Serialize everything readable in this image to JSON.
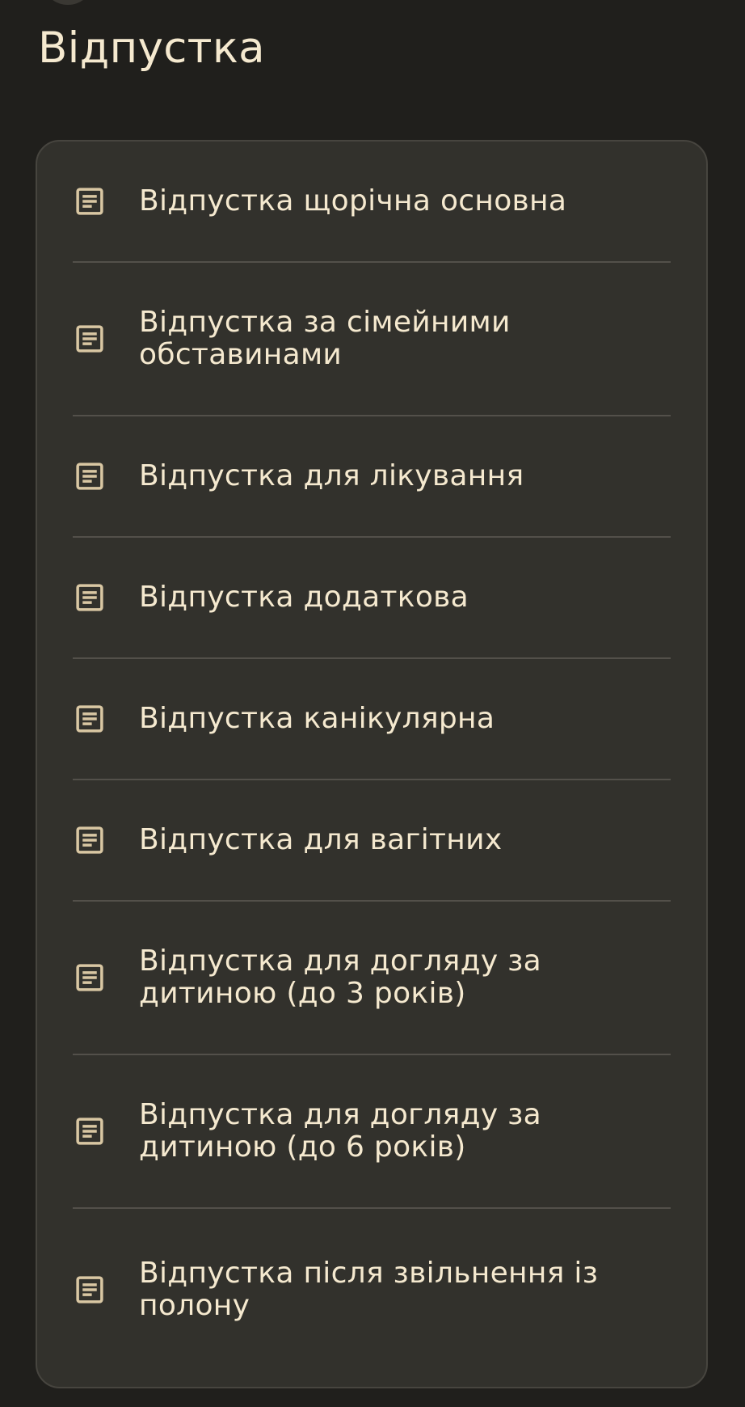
{
  "page": {
    "title": "Відпустка"
  },
  "leave_types": {
    "items": [
      {
        "label": "Відпустка щорічна основна",
        "icon": "document-icon"
      },
      {
        "label": "Відпустка за сімейними обставинами",
        "icon": "document-icon"
      },
      {
        "label": "Відпустка для лікування",
        "icon": "document-icon"
      },
      {
        "label": "Відпустка додаткова",
        "icon": "document-icon"
      },
      {
        "label": "Відпустка канікулярна",
        "icon": "document-icon"
      },
      {
        "label": "Відпустка для вагітних",
        "icon": "document-icon"
      },
      {
        "label": "Відпустка для догляду за дитиною (до 3 років)",
        "icon": "document-icon"
      },
      {
        "label": "Відпустка для догляду за дитиною (до 6 років)",
        "icon": "document-icon"
      },
      {
        "label": "Відпустка після звільнення із полону",
        "icon": "document-icon"
      }
    ]
  },
  "colors": {
    "background": "#201f1c",
    "card": "#32312c",
    "text": "#f5e9cf",
    "icon": "#d9c7a3",
    "divider": "#53504a"
  }
}
